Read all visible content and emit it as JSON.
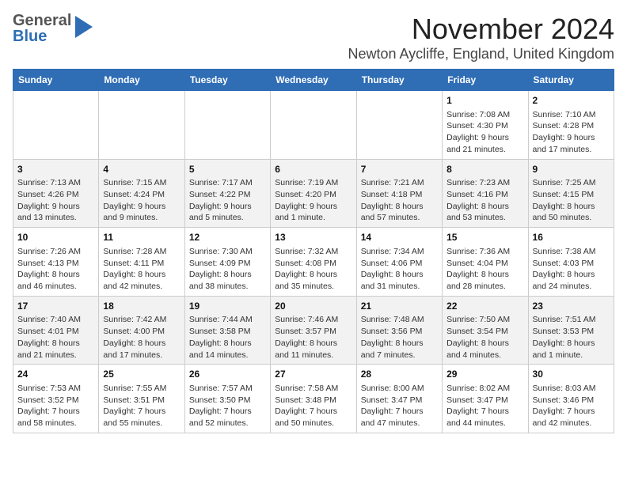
{
  "header": {
    "logo_line1": "General",
    "logo_line2": "Blue",
    "month": "November 2024",
    "location": "Newton Aycliffe, England, United Kingdom"
  },
  "weekdays": [
    "Sunday",
    "Monday",
    "Tuesday",
    "Wednesday",
    "Thursday",
    "Friday",
    "Saturday"
  ],
  "weeks": [
    [
      {
        "day": "",
        "info": ""
      },
      {
        "day": "",
        "info": ""
      },
      {
        "day": "",
        "info": ""
      },
      {
        "day": "",
        "info": ""
      },
      {
        "day": "",
        "info": ""
      },
      {
        "day": "1",
        "info": "Sunrise: 7:08 AM\nSunset: 4:30 PM\nDaylight: 9 hours and 21 minutes."
      },
      {
        "day": "2",
        "info": "Sunrise: 7:10 AM\nSunset: 4:28 PM\nDaylight: 9 hours and 17 minutes."
      }
    ],
    [
      {
        "day": "3",
        "info": "Sunrise: 7:13 AM\nSunset: 4:26 PM\nDaylight: 9 hours and 13 minutes."
      },
      {
        "day": "4",
        "info": "Sunrise: 7:15 AM\nSunset: 4:24 PM\nDaylight: 9 hours and 9 minutes."
      },
      {
        "day": "5",
        "info": "Sunrise: 7:17 AM\nSunset: 4:22 PM\nDaylight: 9 hours and 5 minutes."
      },
      {
        "day": "6",
        "info": "Sunrise: 7:19 AM\nSunset: 4:20 PM\nDaylight: 9 hours and 1 minute."
      },
      {
        "day": "7",
        "info": "Sunrise: 7:21 AM\nSunset: 4:18 PM\nDaylight: 8 hours and 57 minutes."
      },
      {
        "day": "8",
        "info": "Sunrise: 7:23 AM\nSunset: 4:16 PM\nDaylight: 8 hours and 53 minutes."
      },
      {
        "day": "9",
        "info": "Sunrise: 7:25 AM\nSunset: 4:15 PM\nDaylight: 8 hours and 50 minutes."
      }
    ],
    [
      {
        "day": "10",
        "info": "Sunrise: 7:26 AM\nSunset: 4:13 PM\nDaylight: 8 hours and 46 minutes."
      },
      {
        "day": "11",
        "info": "Sunrise: 7:28 AM\nSunset: 4:11 PM\nDaylight: 8 hours and 42 minutes."
      },
      {
        "day": "12",
        "info": "Sunrise: 7:30 AM\nSunset: 4:09 PM\nDaylight: 8 hours and 38 minutes."
      },
      {
        "day": "13",
        "info": "Sunrise: 7:32 AM\nSunset: 4:08 PM\nDaylight: 8 hours and 35 minutes."
      },
      {
        "day": "14",
        "info": "Sunrise: 7:34 AM\nSunset: 4:06 PM\nDaylight: 8 hours and 31 minutes."
      },
      {
        "day": "15",
        "info": "Sunrise: 7:36 AM\nSunset: 4:04 PM\nDaylight: 8 hours and 28 minutes."
      },
      {
        "day": "16",
        "info": "Sunrise: 7:38 AM\nSunset: 4:03 PM\nDaylight: 8 hours and 24 minutes."
      }
    ],
    [
      {
        "day": "17",
        "info": "Sunrise: 7:40 AM\nSunset: 4:01 PM\nDaylight: 8 hours and 21 minutes."
      },
      {
        "day": "18",
        "info": "Sunrise: 7:42 AM\nSunset: 4:00 PM\nDaylight: 8 hours and 17 minutes."
      },
      {
        "day": "19",
        "info": "Sunrise: 7:44 AM\nSunset: 3:58 PM\nDaylight: 8 hours and 14 minutes."
      },
      {
        "day": "20",
        "info": "Sunrise: 7:46 AM\nSunset: 3:57 PM\nDaylight: 8 hours and 11 minutes."
      },
      {
        "day": "21",
        "info": "Sunrise: 7:48 AM\nSunset: 3:56 PM\nDaylight: 8 hours and 7 minutes."
      },
      {
        "day": "22",
        "info": "Sunrise: 7:50 AM\nSunset: 3:54 PM\nDaylight: 8 hours and 4 minutes."
      },
      {
        "day": "23",
        "info": "Sunrise: 7:51 AM\nSunset: 3:53 PM\nDaylight: 8 hours and 1 minute."
      }
    ],
    [
      {
        "day": "24",
        "info": "Sunrise: 7:53 AM\nSunset: 3:52 PM\nDaylight: 7 hours and 58 minutes."
      },
      {
        "day": "25",
        "info": "Sunrise: 7:55 AM\nSunset: 3:51 PM\nDaylight: 7 hours and 55 minutes."
      },
      {
        "day": "26",
        "info": "Sunrise: 7:57 AM\nSunset: 3:50 PM\nDaylight: 7 hours and 52 minutes."
      },
      {
        "day": "27",
        "info": "Sunrise: 7:58 AM\nSunset: 3:48 PM\nDaylight: 7 hours and 50 minutes."
      },
      {
        "day": "28",
        "info": "Sunrise: 8:00 AM\nSunset: 3:47 PM\nDaylight: 7 hours and 47 minutes."
      },
      {
        "day": "29",
        "info": "Sunrise: 8:02 AM\nSunset: 3:47 PM\nDaylight: 7 hours and 44 minutes."
      },
      {
        "day": "30",
        "info": "Sunrise: 8:03 AM\nSunset: 3:46 PM\nDaylight: 7 hours and 42 minutes."
      }
    ]
  ]
}
